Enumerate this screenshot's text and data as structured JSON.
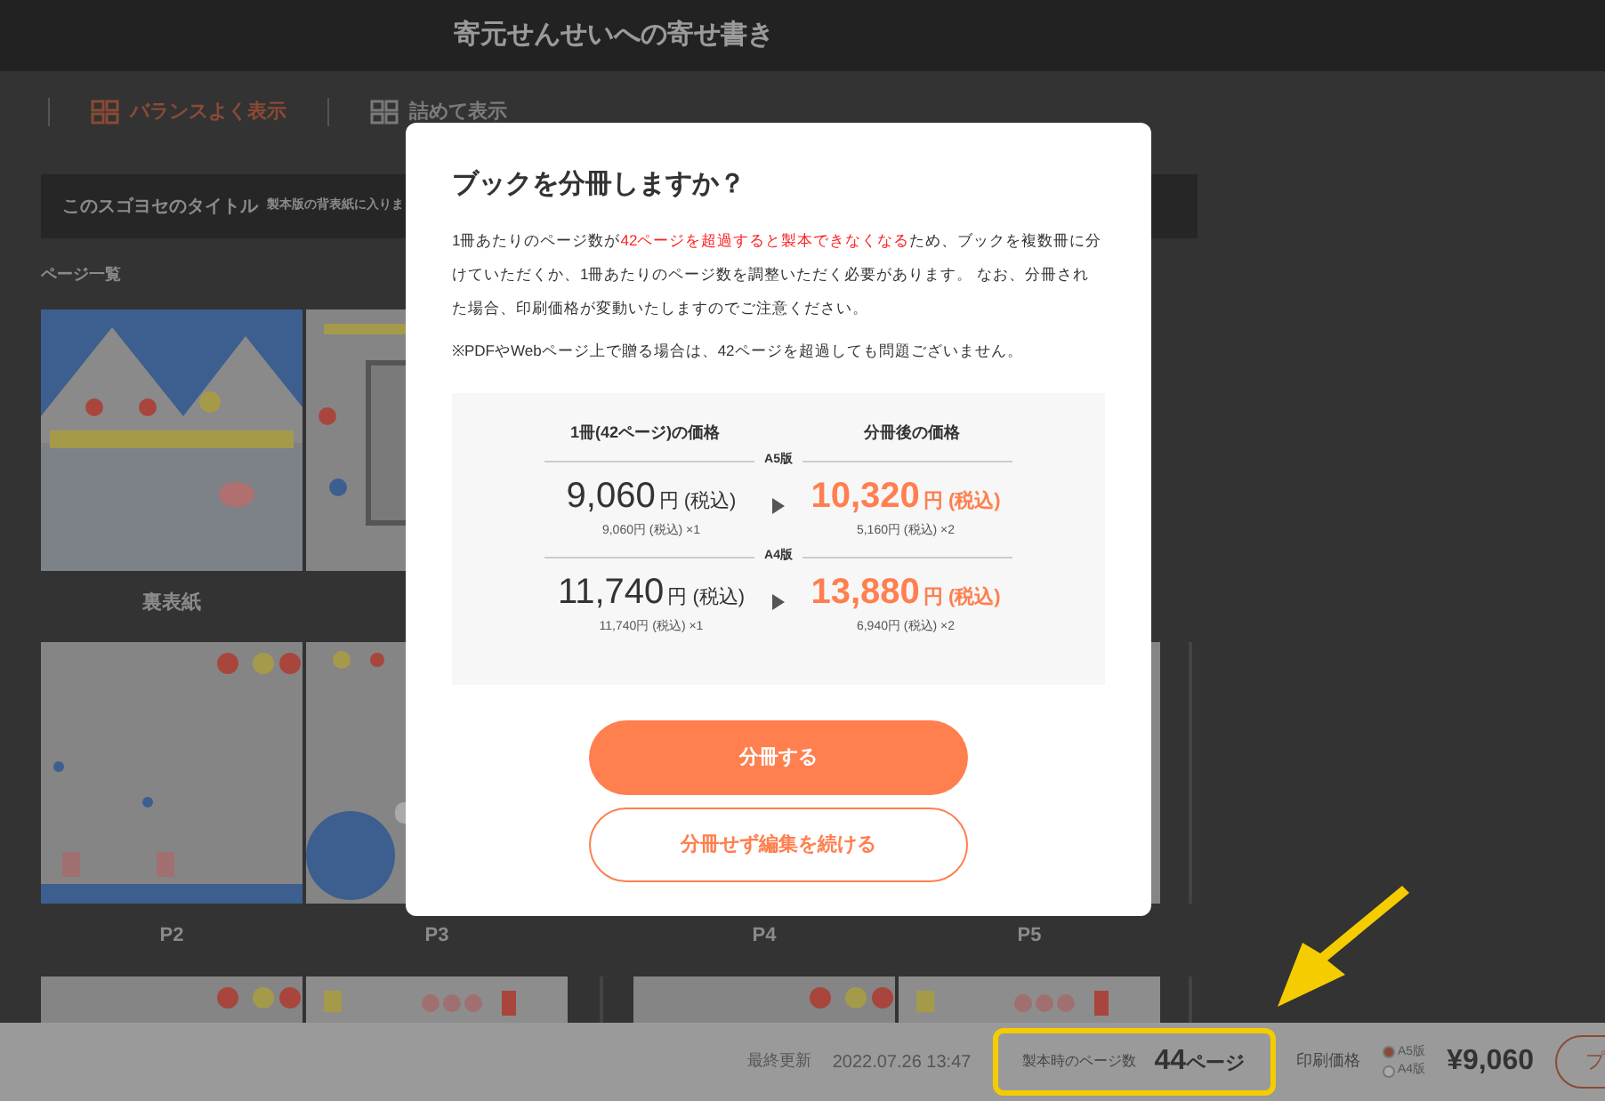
{
  "header": {
    "title": "寄元せんせいへの寄せ書き"
  },
  "view_options": [
    {
      "label": "バランスよく表示",
      "selected": true
    },
    {
      "label": "詰めて表示",
      "selected": false
    }
  ],
  "title_bar": {
    "title": "このスゴヨセのタイトル",
    "hint": "製本版の背表紙に入りま"
  },
  "page_list": {
    "heading": "ページ一覧",
    "rows": [
      {
        "pages": [
          {
            "label": "裏表紙",
            "kind": "cover"
          },
          {
            "kind": "board"
          }
        ]
      },
      {
        "pages": [
          {
            "label": "P2",
            "kind": "flowers"
          },
          {
            "label": "P3",
            "kind": "circle"
          },
          {
            "label": "P4"
          },
          {
            "label": "P5",
            "kind": "plain"
          }
        ]
      },
      {
        "pages": [
          {
            "kind": "flowers"
          },
          {
            "kind": "hearts"
          },
          {
            "kind": "flowers"
          },
          {
            "kind": "hearts"
          }
        ]
      }
    ]
  },
  "dialog": {
    "title": "ブックを分冊しますか？",
    "message": [
      {
        "text": "1冊あたりのページ数が",
        "highlight": false
      },
      {
        "text": "42ページを超過すると製本できなくなる",
        "highlight": true
      },
      {
        "text": "ため、ブックを複数冊に分けていただくか、1冊あたりのページ数を調整いただく必要があります。 なお、分冊された場合、印刷価格が変動いたしますのでご注意ください。",
        "highlight": false
      }
    ],
    "note": "※PDFやWebページ上で贈る場合は、42ページを超過しても問題ございません。",
    "price_table": {
      "before_heading": "1冊(42ページ)の価格",
      "after_heading": "分冊後の価格",
      "sizes": [
        {
          "label": "A5版",
          "before": "9,060",
          "before_unit": "円 (税込)",
          "before_detail": "9,060円 (税込) ×1",
          "after": "10,320",
          "after_unit": "円 (税込)",
          "after_detail": "5,160円 (税込) ×2"
        },
        {
          "label": "A4版",
          "before": "11,740",
          "before_unit": "円 (税込)",
          "before_detail": "11,740円 (税込) ×1",
          "after": "13,880",
          "after_unit": "円 (税込)",
          "after_detail": "6,940円 (税込) ×2"
        }
      ]
    },
    "buttons": [
      {
        "label": "分冊する",
        "kind": "primary"
      },
      {
        "label": "分冊せず編集を続ける",
        "kind": "secondary"
      }
    ]
  },
  "footer": {
    "updated_label": "最終更新",
    "updated": "2022.07.26 13:47",
    "page_count_label": "製本時のページ数",
    "page_count": "44",
    "page_unit": "ページ",
    "price_label": "印刷価格",
    "sizes": [
      {
        "label": "A5版",
        "selected": true
      },
      {
        "label": "A4版",
        "selected": false
      }
    ],
    "price": "¥9,060",
    "button": "プ"
  }
}
